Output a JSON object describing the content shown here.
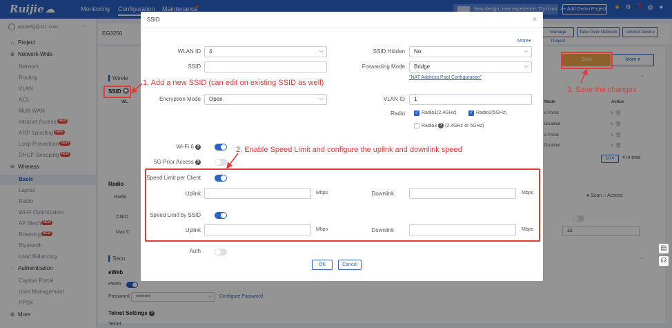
{
  "topbar": {
    "logo": "Ruijie",
    "nav": [
      "Monitoring",
      "Configuration",
      "Maintenance"
    ],
    "banner": "New design, new experience. Try it out. >",
    "add_demo": "+ Add Demo Project",
    "icons": [
      "gift-icon",
      "settings-icon",
      "help-icon",
      "globe-icon",
      "user-icon"
    ]
  },
  "sidebar": {
    "account": "abcdefg@111.com",
    "project": "Project",
    "network_wide": "Network-Wide",
    "nw_items": [
      "Network",
      "Routing",
      "VLAN",
      "ACL",
      "Multi-WAN",
      "Intranet Access",
      "ARP Spoofing",
      "Loop Prevention",
      "DHCP Snooping"
    ],
    "wireless": "Wireless",
    "w_items": [
      "Basic",
      "Layout",
      "Radio",
      "Wi-Fi Optimization",
      "AP Mesh",
      "Roaming",
      "Bluetooth",
      "Load Balancing"
    ],
    "authentication": "Authentication",
    "a_items": [
      "Captive Portal",
      "User Management",
      "PPSK"
    ],
    "more": "More",
    "new_badge": "NEW"
  },
  "background": {
    "device": "EG3250",
    "manage_project": "Manage Project",
    "take_over": "Take Over Network",
    "unbind": "Unbind Device",
    "save": "Save",
    "more": "More",
    "wireless_section": "Wirele",
    "ssid_tab": "SSID",
    "wl_col": "WL",
    "mode_header": "Mode",
    "action_header": "Action",
    "rows": [
      "e Portal",
      "Disabled",
      "e Portal",
      "Disabled"
    ],
    "page_size": "10",
    "total": "4 in total",
    "radio_title": "Radio",
    "radio_lbl": "Radio",
    "onoff": "ON/O",
    "max": "Max C",
    "scan": "Scan",
    "access": "Access",
    "value_32": "32",
    "security": "Secu",
    "eweb_title": "eWeb",
    "eweb_lbl": "eWeb",
    "password_lbl": "Password",
    "password_val": "••••••••••",
    "configure_password": "Configure Password",
    "telnet": "Telnet Settings",
    "telnet_lbl": "Telnet"
  },
  "modal": {
    "title": "SSID",
    "more": "More",
    "wlan_id_label": "WLAN ID",
    "wlan_id_value": "4",
    "ssid_label": "SSID",
    "ssid_value": "",
    "ssid_hidden_label": "SSID Hidden",
    "ssid_hidden_value": "No",
    "forwarding_label": "Forwarding Mode",
    "forwarding_value": "Bridge",
    "nat_link": "NAT Address Pool Configuration",
    "encryption_label": "Encryption Mode",
    "encryption_value": "Open",
    "vlan_label": "VLAN ID",
    "vlan_value": "1",
    "radio_label": "Radio",
    "radio1": "Radio1(2.4GHz)",
    "radio2": "Radio2(5GHz)",
    "radio3": "Radio3",
    "radio3_note": "(2.4GHz or 5GHz)",
    "wifi6_label": "Wi-Fi 6",
    "prior_label": "5G-Prior Access",
    "speed_client_label": "Speed Limit per Client",
    "speed_ssid_label": "Speed Limit by SSID",
    "uplink_label": "Uplink",
    "downlink_label": "Downlink",
    "unit": "Mbps",
    "auth_label": "Auth",
    "ok": "OK",
    "cancel": "Cancel"
  },
  "annotations": {
    "step1": "1. Add a new SSID (can edit on existing SSID as well)",
    "step2": "2. Enable Speed Limit and configure the uplink and downlink speed",
    "step3": "3. Save the changes"
  },
  "colors": {
    "primary": "#2b62c9",
    "annotation": "#e53935",
    "save": "#f5a64a"
  }
}
